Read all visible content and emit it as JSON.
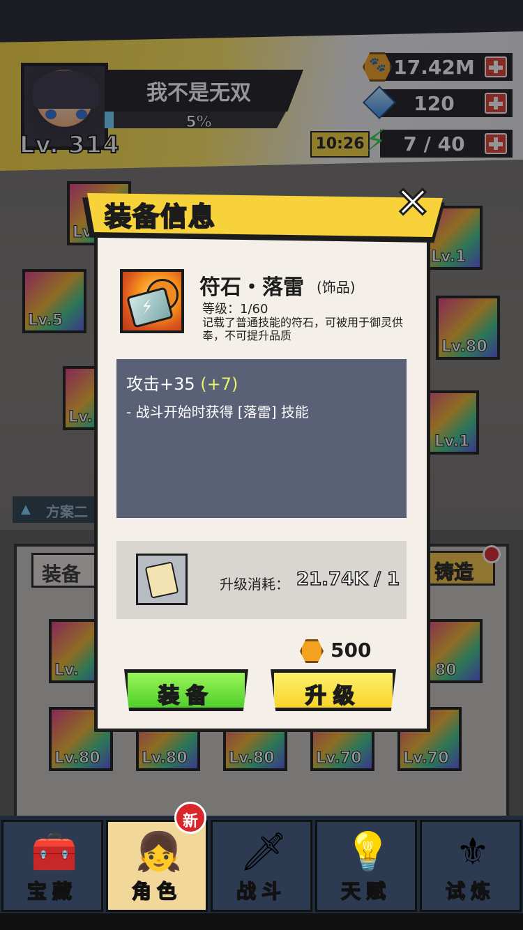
{
  "header": {
    "player_name": "我不是无双",
    "level": "Lv. 314",
    "exp_percent_label": "5%",
    "exp_fraction": 0.05,
    "coins": "17.42M",
    "gems": "120",
    "energy": "7 / 40",
    "energy_timer": "10:26"
  },
  "background_tiles": {
    "left": [
      "Lv.",
      "Lv.5",
      "Lv."
    ],
    "right": [
      "Lv.1",
      "Lv.80",
      "Lv.1"
    ],
    "grid_row1": [
      "Lv.",
      "80"
    ],
    "grid_row2": [
      "Lv.80",
      "Lv.80",
      "Lv.80",
      "Lv.70",
      "Lv.70"
    ]
  },
  "scheme_label": "方案二",
  "tabs": {
    "equip": "装备",
    "forge": "铸造"
  },
  "modal": {
    "title": "装备信息",
    "close": "✕",
    "item": {
      "name": "符石・落雷",
      "type": "(饰品)",
      "level": "等级：1/60",
      "description": "记载了普通技能的符石，可被用于御灵供奉，不可提升品质"
    },
    "stats": {
      "main": "攻击+35 ",
      "bonus": "(+7)",
      "skill": "- 战斗开始时获得 [落雷] 技能"
    },
    "cost": {
      "label": "升级消耗：",
      "value": "21.74K / 1"
    },
    "price": "500",
    "buttons": {
      "equip": "装备",
      "upgrade": "升级"
    }
  },
  "nav": {
    "items": [
      {
        "label": "宝藏",
        "icon": "treasure-chest-icon"
      },
      {
        "label": "角色",
        "icon": "character-icon"
      },
      {
        "label": "战斗",
        "icon": "sword-icon"
      },
      {
        "label": "天赋",
        "icon": "lightbulb-icon"
      },
      {
        "label": "试炼",
        "icon": "trial-emblem-icon"
      }
    ],
    "new_badge": "新"
  },
  "colors": {
    "accent_yellow": "#f7d23a",
    "equip_green": "#4fcf2a",
    "stat_panel": "#5a6075"
  }
}
